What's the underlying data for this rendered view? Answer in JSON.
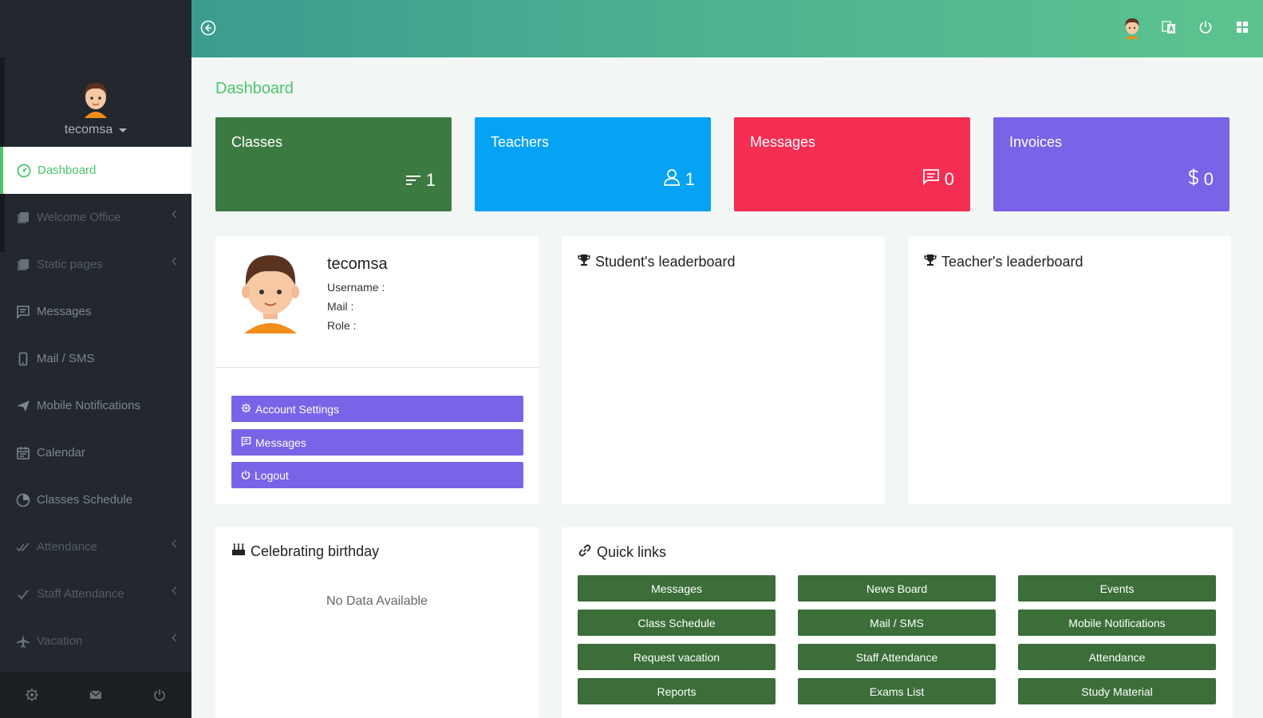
{
  "sidebar": {
    "user_name": "tecomsa",
    "items": [
      {
        "label": "Dashboard",
        "icon": "dashboard-icon"
      },
      {
        "label": "Welcome Office",
        "icon": "library-icon"
      },
      {
        "label": "Static pages",
        "icon": "library-icon"
      },
      {
        "label": "Messages",
        "icon": "message-icon"
      },
      {
        "label": "Mail / SMS",
        "icon": "phone-icon"
      },
      {
        "label": "Mobile Notifications",
        "icon": "paper-plane-icon"
      },
      {
        "label": "Calendar",
        "icon": "calendar-icon"
      },
      {
        "label": "Classes Schedule",
        "icon": "pie-chart-icon"
      },
      {
        "label": "Attendance",
        "icon": "double-check-icon"
      },
      {
        "label": "Staff Attendance",
        "icon": "check-icon"
      },
      {
        "label": "Vacation",
        "icon": "airplane-icon"
      }
    ],
    "footer_icons": [
      "gear-icon",
      "mail-icon",
      "power-icon"
    ]
  },
  "topbar": {
    "icons": [
      "back-circle-icon",
      "user-avatar-icon",
      "language-icon",
      "power-icon",
      "grid-icon"
    ]
  },
  "page": {
    "title": "Dashboard"
  },
  "stats": [
    {
      "title": "Classes",
      "value": "1",
      "icon": "sort-lines-icon",
      "color": "#3d7a41"
    },
    {
      "title": "Teachers",
      "value": "1",
      "icon": "user-outline-icon",
      "color": "#06a3f4"
    },
    {
      "title": "Messages",
      "value": "0",
      "icon": "message-icon",
      "color": "#f42d52"
    },
    {
      "title": "Invoices",
      "value": "0",
      "icon": "dollar-icon",
      "color": "#7b63e8"
    }
  ],
  "profile_card": {
    "name": "tecomsa",
    "username_label": "Username :",
    "mail_label": "Mail :",
    "role_label": "Role :",
    "buttons": [
      {
        "label": "Account Settings",
        "icon": "gear-icon"
      },
      {
        "label": "Messages",
        "icon": "message-icon"
      },
      {
        "label": "Logout",
        "icon": "power-icon"
      }
    ]
  },
  "leaderboards": {
    "students": "Student's leaderboard",
    "teachers": "Teacher's leaderboard"
  },
  "birthday": {
    "title": "Celebrating birthday",
    "empty": "No Data Available"
  },
  "quick_links": {
    "title": "Quick links",
    "items": [
      "Messages",
      "News Board",
      "Events",
      "Class Schedule",
      "Mail / SMS",
      "Mobile Notifications",
      "Request vacation",
      "Staff Attendance",
      "Attendance",
      "Reports",
      "Exams List",
      "Study Material"
    ]
  },
  "colors": {
    "accent": "#4dc46d",
    "sidebar_bg": "#22282d",
    "button_purple": "#7b63e8",
    "quick_link_green": "#3b6e38"
  }
}
